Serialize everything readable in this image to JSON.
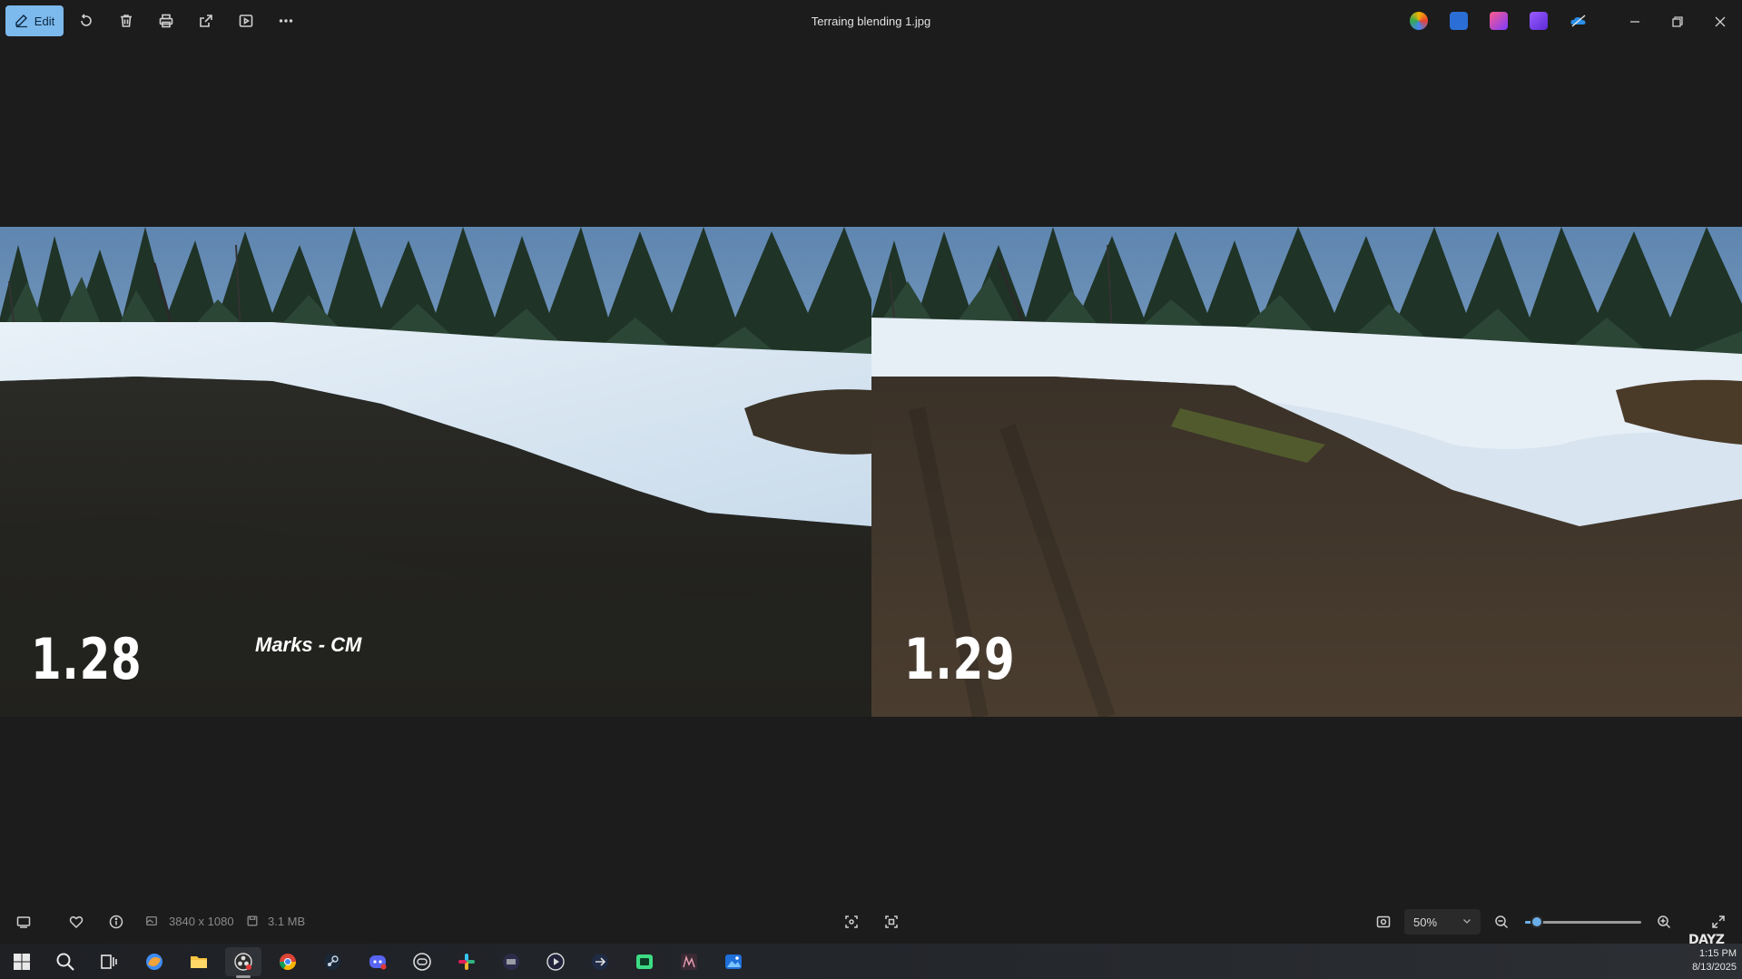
{
  "toolbar": {
    "edit_label": "Edit",
    "icons": [
      "edit-icon",
      "rotate-icon",
      "delete-icon",
      "print-icon",
      "share-icon",
      "slideshow-icon",
      "more-icon"
    ]
  },
  "window": {
    "title": "Terraing blending 1.jpg",
    "app_icons": [
      "copilot-icon",
      "designer-icon",
      "clipchamp-icon",
      "teams-icon",
      "onedrive-icon"
    ]
  },
  "image": {
    "left_version": "1.28",
    "right_version": "1.29",
    "credit": "Marks - CM"
  },
  "statusbar": {
    "dimensions": "3840 x 1080",
    "file_size": "3.1 MB",
    "zoom_value": "50%",
    "zoom_level": 0.1
  },
  "taskbar": {
    "apps": [
      "start-icon",
      "search-icon",
      "task-view-icon",
      "copilot-icon",
      "file-explorer-icon",
      "obs-icon",
      "chrome-icon",
      "steam-icon",
      "discord-icon",
      "app-icon",
      "slack-icon",
      "app-icon",
      "media-player-icon",
      "app-icon",
      "app-icon",
      "app-icon",
      "photos-icon"
    ],
    "tray_logo": "DAYZ",
    "time": "1:15 PM",
    "date": "8/13/2025"
  },
  "colors": {
    "accent": "#7cb9ec",
    "slider": "#6aaee8",
    "background": "#1c1c1c"
  }
}
